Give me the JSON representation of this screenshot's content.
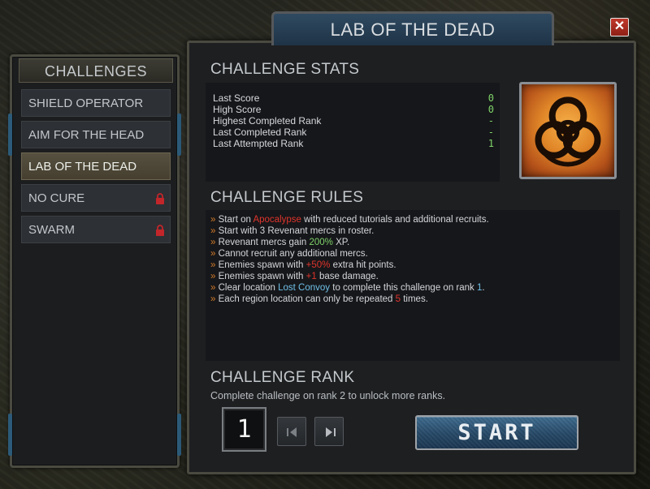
{
  "window": {
    "title": "LAB OF THE DEAD",
    "close_symbol": "✕"
  },
  "sidebar": {
    "title": "CHALLENGES",
    "items": [
      {
        "label": "SHIELD OPERATOR",
        "active": false,
        "locked": false
      },
      {
        "label": "AIM FOR THE HEAD",
        "active": false,
        "locked": false
      },
      {
        "label": "LAB OF THE DEAD",
        "active": true,
        "locked": false
      },
      {
        "label": "NO CURE",
        "active": false,
        "locked": true
      },
      {
        "label": "SWARM",
        "active": false,
        "locked": true
      }
    ]
  },
  "stats": {
    "title": "CHALLENGE STATS",
    "rows": [
      {
        "label": "Last Score",
        "value": "0"
      },
      {
        "label": "High Score",
        "value": "0"
      },
      {
        "label": "Highest Completed Rank",
        "value": "-"
      },
      {
        "label": "Last Completed Rank",
        "value": "-"
      },
      {
        "label": "Last Attempted Rank",
        "value": "1"
      }
    ],
    "emblem_icon": "biohazard-icon"
  },
  "rules": {
    "title": "CHALLENGE RULES",
    "bullet": "»",
    "lines": [
      {
        "pre": "Start on ",
        "hl": "Apocalypse",
        "post": " with reduced tutorials and additional recruits.",
        "hl_color": "red"
      },
      {
        "pre": "Start with 3 Revenant mercs in roster.",
        "hl": "",
        "post": "",
        "hl_color": ""
      },
      {
        "pre": "Revenant mercs gain ",
        "hl": "200%",
        "post": " XP.",
        "hl_color": "green"
      },
      {
        "pre": "Cannot recruit any additional mercs.",
        "hl": "",
        "post": "",
        "hl_color": ""
      },
      {
        "pre": "Enemies spawn with ",
        "hl": "+50%",
        "post": " extra hit points.",
        "hl_color": "red"
      },
      {
        "pre": "Enemies spawn with ",
        "hl": "+1",
        "post": " base damage.",
        "hl_color": "red"
      },
      {
        "pre": "Clear location ",
        "hl": "Lost Convoy",
        "post": " to complete this challenge on rank ",
        "hl_color": "blue",
        "hl2": "1",
        "post2": "."
      },
      {
        "pre": "Each region location can only be repeated ",
        "hl": "5",
        "post": " times.",
        "hl_color": "red"
      }
    ]
  },
  "rank": {
    "title": "CHALLENGE RANK",
    "subtitle": "Complete challenge on rank 2 to unlock more ranks.",
    "value": "1",
    "prev_icon": "arrow-left-icon",
    "next_icon": "arrow-right-icon"
  },
  "start_button": {
    "label": "START"
  },
  "colors": {
    "accent_blue": "#264866",
    "highlight_red": "#e0342c",
    "highlight_green": "#7fd36a",
    "highlight_blue": "#6fc0e8",
    "active_item": "#55503f"
  }
}
